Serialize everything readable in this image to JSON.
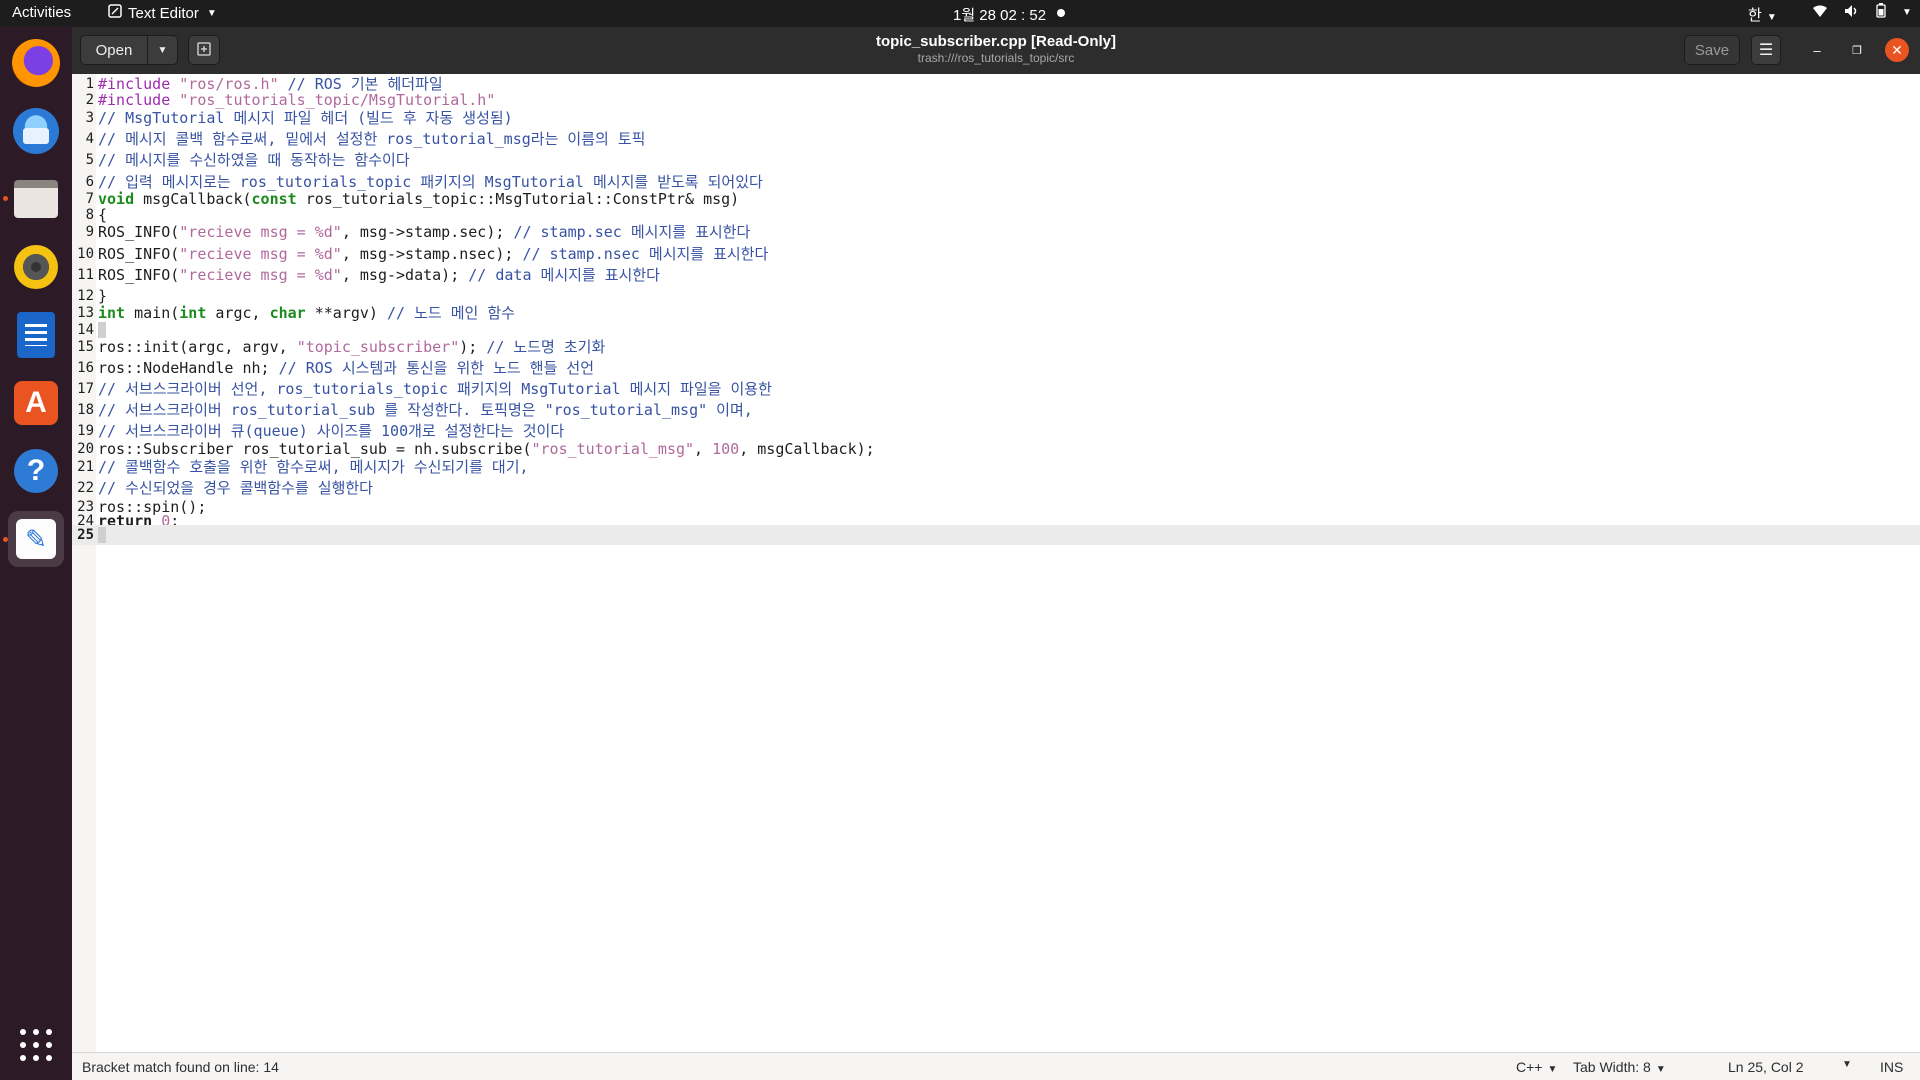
{
  "topbar": {
    "activities": "Activities",
    "app_name": "Text Editor",
    "clock": "1월 28  02 : 52",
    "input_method": "한"
  },
  "dock": {
    "items": [
      "firefox-icon",
      "thunderbird-icon",
      "files-icon",
      "rhythmbox-icon",
      "libreoffice-writer-icon",
      "ubuntu-software-icon",
      "help-icon",
      "text-editor-icon",
      "show-applications-icon"
    ]
  },
  "headerbar": {
    "open_label": "Open",
    "save_label": "Save",
    "title": "topic_subscriber.cpp [Read-Only]",
    "path": "trash:///ros_tutorials_topic/src"
  },
  "editor": {
    "current_line": 25,
    "lines": [
      "#include \"ros/ros.h\" // ROS 기본 헤더파일",
      "#include \"ros_tutorials_topic/MsgTutorial.h\"",
      "// MsgTutorial 메시지 파일 헤더 (빌드 후 자동 생성됨)",
      "// 메시지 콜백 함수로써, 밑에서 설정한 ros_tutorial_msg라는 이름의 토픽",
      "// 메시지를 수신하였을 때 동작하는 함수이다",
      "// 입력 메시지로는 ros_tutorials_topic 패키지의 MsgTutorial 메시지를 받도록 되어있다",
      "void msgCallback(const ros_tutorials_topic::MsgTutorial::ConstPtr& msg)",
      "{",
      "ROS_INFO(\"recieve msg = %d\", msg->stamp.sec); // stamp.sec 메시지를 표시한다",
      "ROS_INFO(\"recieve msg = %d\", msg->stamp.nsec); // stamp.nsec 메시지를 표시한다",
      "ROS_INFO(\"recieve msg = %d\", msg->data); // data 메시지를 표시한다",
      "}",
      "int main(int argc, char **argv) // 노드 메인 함수",
      "{",
      "ros::init(argc, argv, \"topic_subscriber\"); // 노드명 초기화",
      "ros::NodeHandle nh; // ROS 시스템과 통신을 위한 노드 핸들 선언",
      "// 서브스크라이버 선언, ros_tutorials_topic 패키지의 MsgTutorial 메시지 파일을 이용한",
      "// 서브스크라이버 ros_tutorial_sub 를 작성한다. 토픽명은 \"ros_tutorial_msg\" 이며,",
      "// 서브스크라이버 큐(queue) 사이즈를 100개로 설정한다는 것이다",
      "ros::Subscriber ros_tutorial_sub = nh.subscribe(\"ros_tutorial_msg\", 100, msgCallback);",
      "// 콜백함수 호출을 위한 함수로써, 메시지가 수신되기를 대기,",
      "// 수신되었을 경우 콜백함수를 실행한다",
      "ros::spin();",
      "return 0;",
      "}"
    ]
  },
  "statusbar": {
    "message": "Bracket match found on line: 14",
    "language": "C++",
    "tab_width": "Tab Width: 8",
    "position": "Ln 25, Col 2",
    "mode": "INS"
  }
}
